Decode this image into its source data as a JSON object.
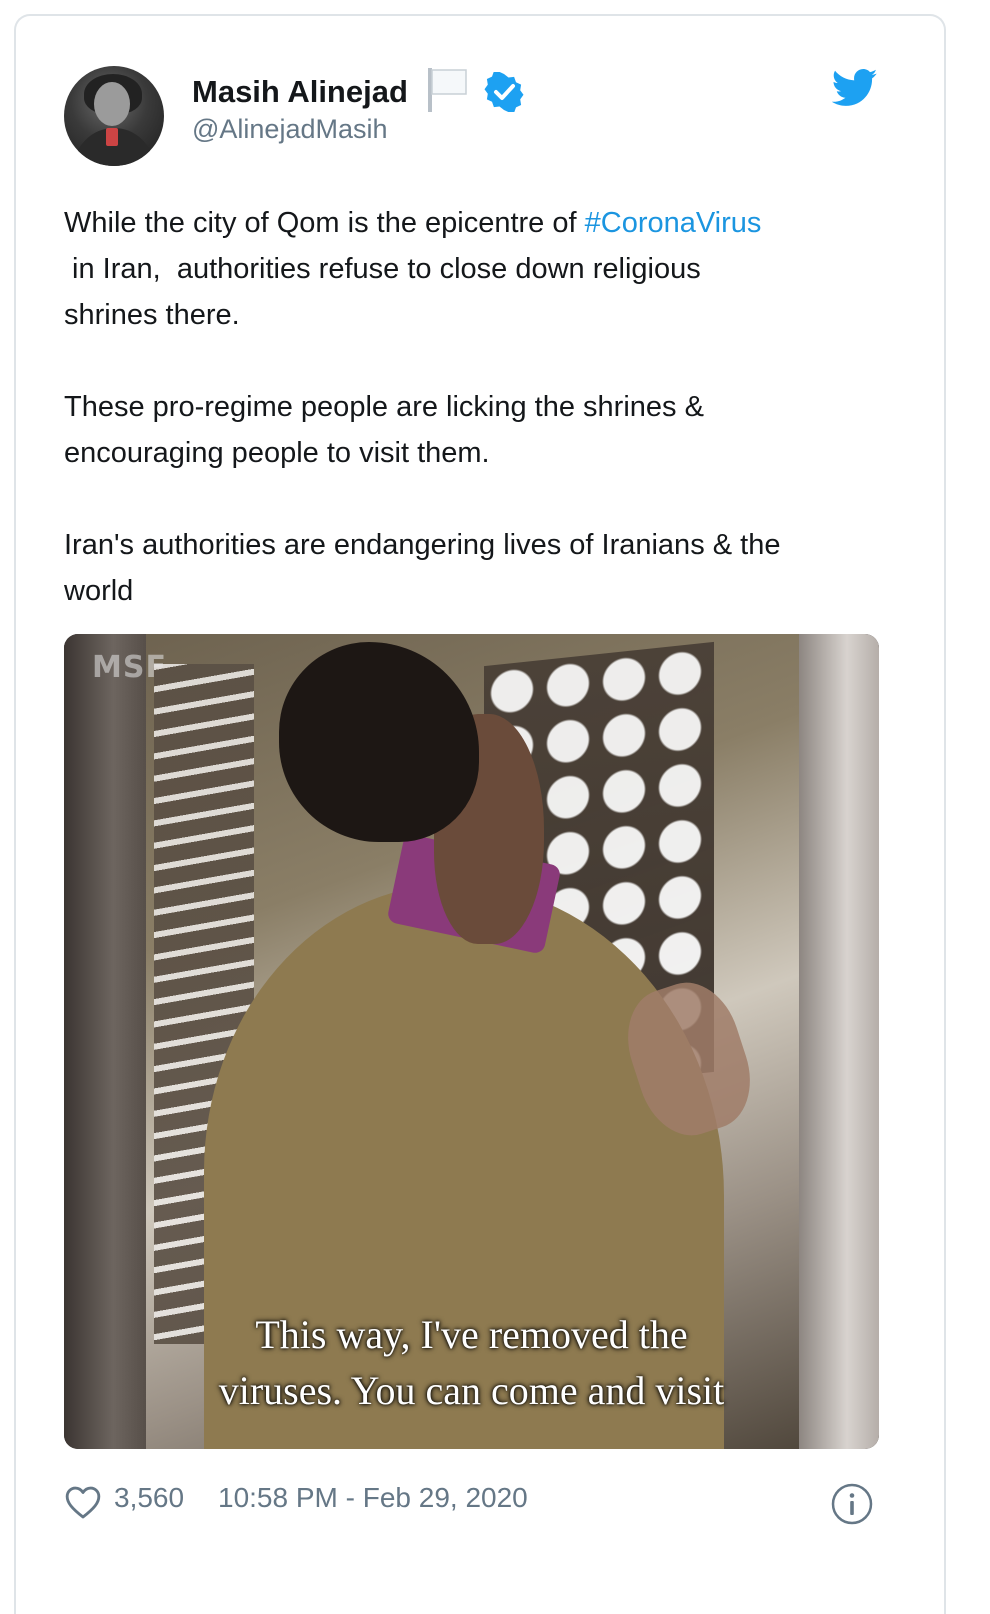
{
  "tweet": {
    "author": {
      "name": "Masih Alinejad",
      "handle": "@AlinejadMasih",
      "verified": true
    },
    "text": {
      "p1_before": "While the city of Qom is the epicentre of ",
      "p1_hashtag": "#CoronaVirus",
      "p1_line2": " in Iran,  authorities refuse to close down religious",
      "p1_line3": "shrines there.",
      "p2_line1": "These pro-regime people are licking the shrines &",
      "p2_line2": "encouraging people to visit them.",
      "p3_line1": "Iran's authorities are endangering lives of Iranians & the",
      "p3_line2": "world"
    },
    "media": {
      "watermark": "MSF",
      "caption_line1": "This way, I've removed the",
      "caption_line2": "viruses. You can come and visit"
    },
    "footer": {
      "likes": "3,560",
      "timestamp": "10:58 PM - Feb 29, 2020"
    }
  },
  "icons": {
    "brand": "twitter-bird-icon",
    "verified": "verified-badge-icon",
    "flag": "white-flag-icon",
    "like": "heart-icon",
    "info": "info-icon"
  },
  "colors": {
    "twitter_blue": "#1da1f2",
    "hashtag": "#1b95e0",
    "secondary_text": "#657786",
    "border": "#dfe4e8"
  }
}
